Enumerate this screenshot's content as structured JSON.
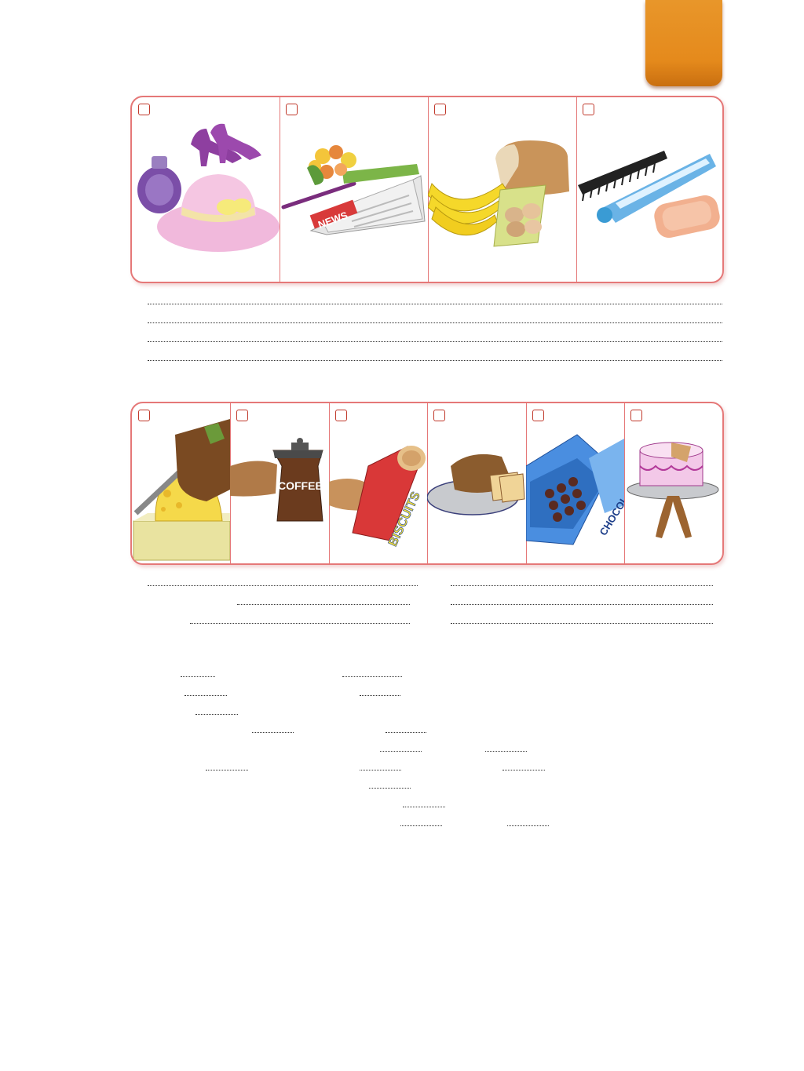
{
  "colors": {
    "accent": "#e58a1c",
    "frame": "#e57878",
    "checkbox": "#c0392b"
  },
  "strip1": {
    "items": [
      {
        "icon": "clothes-perfume-hat-shoes-icon"
      },
      {
        "icon": "flowers-newspaper-pen-icon"
      },
      {
        "icon": "bananas-bread-eggs-icon"
      },
      {
        "icon": "comb-toothpaste-soap-icon"
      }
    ],
    "newspaper_text": "NEWS"
  },
  "strip2": {
    "items": [
      {
        "icon": "cutting-cheese-icon"
      },
      {
        "icon": "coffee-pot-icon"
      },
      {
        "icon": "biscuits-pack-icon"
      },
      {
        "icon": "sliced-bread-icon"
      },
      {
        "icon": "chocolate-box-icon"
      },
      {
        "icon": "cake-stand-icon"
      }
    ],
    "coffee_text": "COFFEE",
    "biscuits_text": "BISCUITS",
    "chocolate_text": "CHOCOLATE"
  }
}
